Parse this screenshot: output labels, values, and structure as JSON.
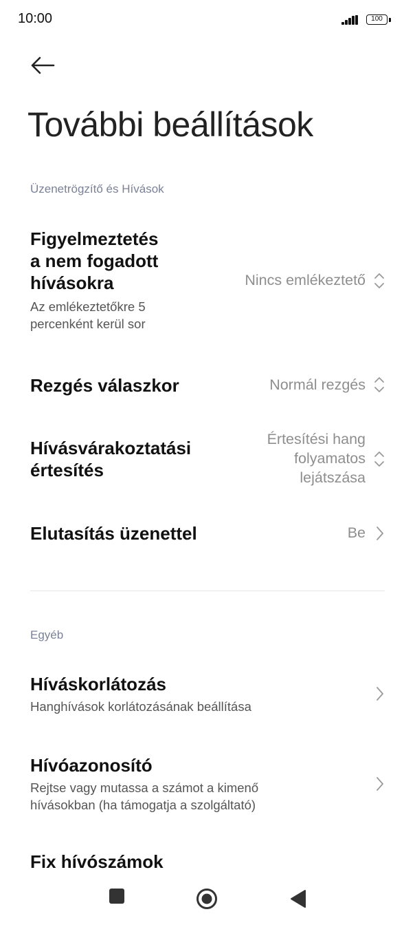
{
  "status_bar": {
    "time": "10:00",
    "battery": "100"
  },
  "page_title": "További beállítások",
  "sections": [
    {
      "header": "Üzenetrögzítő és Hívások",
      "items": [
        {
          "title_lines": [
            "Figyelmeztetés",
            "a nem fogadott",
            "hívásokra"
          ],
          "subtitle_lines": [
            "Az emlékeztetőkre 5",
            "percenként kerül sor"
          ],
          "value": "Nincs emlékeztető",
          "control": "chevron-up-down"
        },
        {
          "title": "Rezgés válaszkor",
          "value": "Normál rezgés",
          "control": "chevron-up-down"
        },
        {
          "title_lines": [
            "Hívásvárakoztatási",
            "értesítés"
          ],
          "value_lines": [
            "Értesítési hang",
            "folyamatos",
            "lejátszása"
          ],
          "control": "chevron-up-down"
        },
        {
          "title": "Elutasítás üzenettel",
          "value": "Be",
          "control": "chevron-right"
        }
      ]
    },
    {
      "header": "Egyéb",
      "items": [
        {
          "title": "Híváskorlátozás",
          "subtitle": "Hanghívások korlátozásának beállítása",
          "control": "chevron-right"
        },
        {
          "title": "Hívóazonosító",
          "subtitle_lines": [
            "Rejtse vagy mutassa a számot a kimenő",
            "hívásokban (ha támogatja a szolgáltató)"
          ],
          "control": "chevron-right"
        },
        {
          "title": "Fix hívószámok"
        }
      ]
    }
  ],
  "navigation_bar": {
    "buttons": [
      "recents",
      "home",
      "back"
    ]
  },
  "colors": {
    "accent_section": "#7b8196",
    "value_text": "#8e8e8e",
    "title_text": "#111111"
  }
}
